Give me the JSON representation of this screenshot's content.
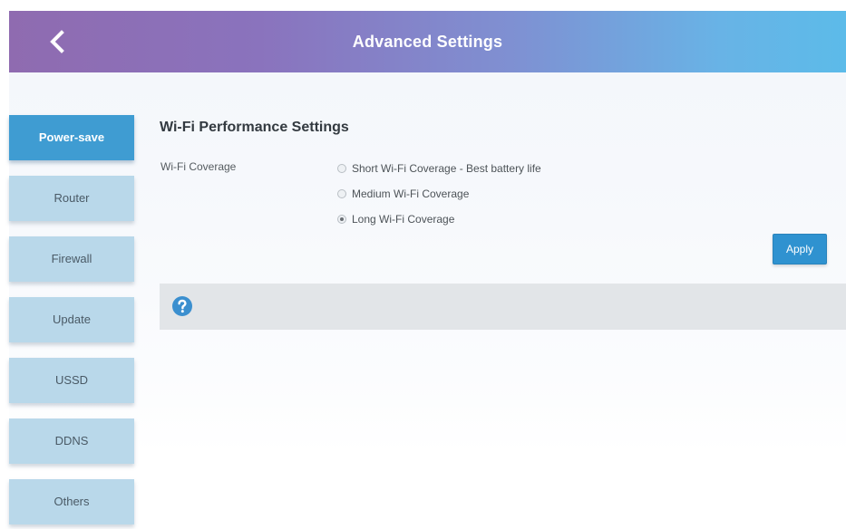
{
  "header": {
    "title": "Advanced Settings",
    "back_icon": "chevron-left-icon"
  },
  "sidebar": {
    "items": [
      {
        "label": "Power-save",
        "active": true
      },
      {
        "label": "Router",
        "active": false
      },
      {
        "label": "Firewall",
        "active": false
      },
      {
        "label": "Update",
        "active": false
      },
      {
        "label": "USSD",
        "active": false
      },
      {
        "label": "DDNS",
        "active": false
      },
      {
        "label": "Others",
        "active": false
      }
    ]
  },
  "main": {
    "section_title": "Wi-Fi Performance Settings",
    "field_label": "Wi-Fi Coverage",
    "options": [
      {
        "label": "Short Wi-Fi Coverage - Best battery life",
        "selected": false
      },
      {
        "label": "Medium Wi-Fi Coverage",
        "selected": false
      },
      {
        "label": "Long Wi-Fi Coverage",
        "selected": true
      }
    ],
    "apply_label": "Apply",
    "help_icon": "question-circle-icon"
  },
  "colors": {
    "active_tab": "#3f9cd2",
    "inactive_tab": "#b9d8ea",
    "apply_button": "#2f92d0",
    "header_gradient_start": "#8f6bb0",
    "header_gradient_end": "#5cbbe9"
  }
}
